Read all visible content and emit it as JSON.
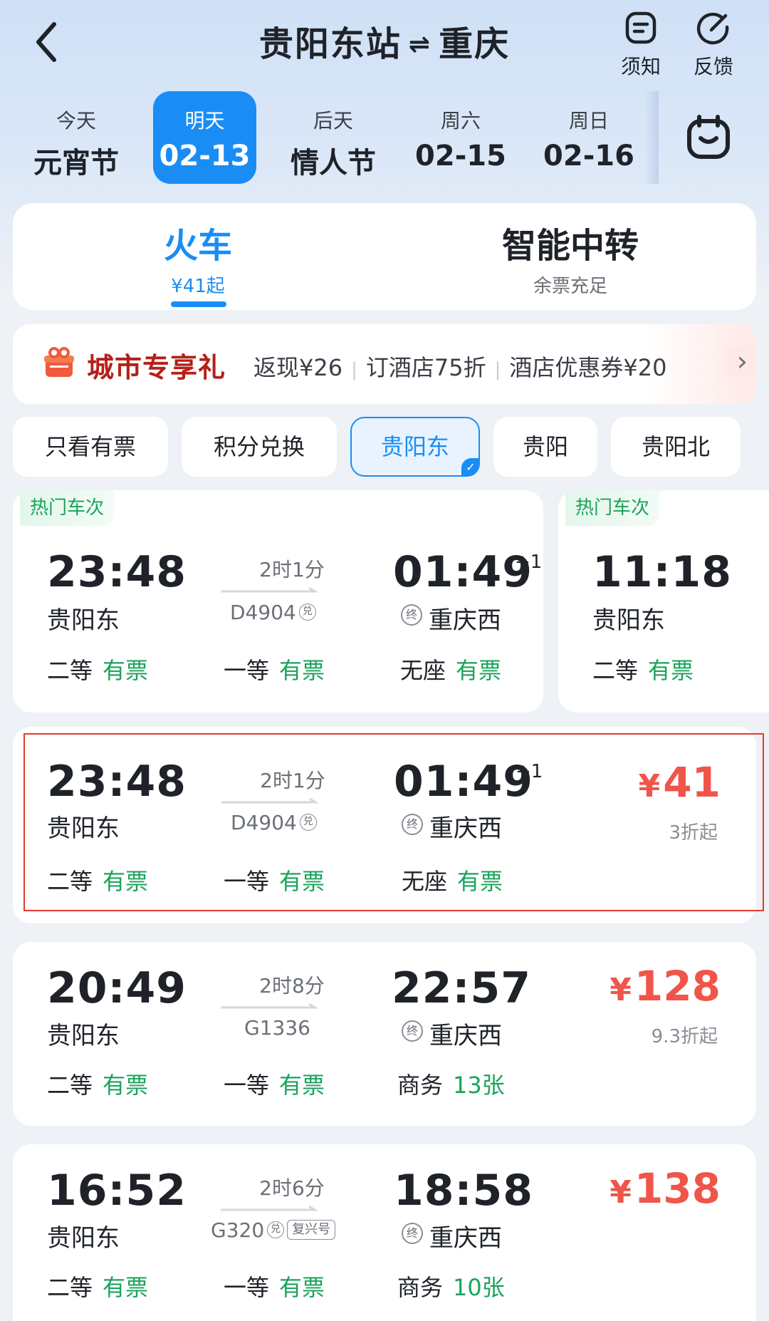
{
  "header": {
    "from": "贵阳东站",
    "swap": "⇌",
    "to": "重庆",
    "notice_label": "须知",
    "feedback_label": "反馈"
  },
  "dates": [
    {
      "top": "今天",
      "bottom": "元宵节",
      "active": false
    },
    {
      "top": "明天",
      "bottom": "02-13",
      "active": true
    },
    {
      "top": "后天",
      "bottom": "情人节",
      "active": false
    },
    {
      "top": "周六",
      "bottom": "02-15",
      "active": false
    },
    {
      "top": "周日",
      "bottom": "02-16",
      "active": false
    }
  ],
  "modes": {
    "train": {
      "title": "火车",
      "sub": "¥41起"
    },
    "transfer": {
      "title": "智能中转",
      "sub": "余票充足"
    }
  },
  "promo": {
    "title": "城市专享礼",
    "items": [
      "返现¥26",
      "订酒店75折",
      "酒店优惠券¥20"
    ],
    "chevron": "›"
  },
  "filters": [
    {
      "label": "只看有票",
      "active": false
    },
    {
      "label": "积分兑换",
      "active": false
    },
    {
      "label": "贵阳东",
      "active": true
    },
    {
      "label": "贵阳",
      "active": false
    },
    {
      "label": "贵阳北",
      "active": false
    }
  ],
  "hot_cards": {
    "card1": {
      "tag": "热门车次",
      "dep_time": "23:48",
      "dep_station": "贵阳东",
      "duration": "2时1分",
      "train_no": "D4904",
      "train_badge": "兑",
      "arr_time": "01:49",
      "plus_day": "+1",
      "arr_station": "重庆西",
      "terminal_icon": "终",
      "seats": [
        {
          "class": "二等",
          "status": "有票"
        },
        {
          "class": "一等",
          "status": "有票"
        },
        {
          "class": "无座",
          "status": "有票"
        }
      ]
    },
    "card2": {
      "tag": "热门车次",
      "dep_time": "11:18",
      "dep_station": "贵阳东",
      "seats": [
        {
          "class": "二等",
          "status": "有票"
        }
      ]
    }
  },
  "trains": [
    {
      "dep_time": "23:48",
      "dep_station": "贵阳东",
      "duration": "2时1分",
      "train_no": "D4904",
      "train_badge": "兑",
      "arr_time": "01:49",
      "plus_day": "+1",
      "arr_station": "重庆西",
      "terminal_icon": "终",
      "price_symbol": "¥",
      "price": "41",
      "discount": "3折起",
      "seats": [
        {
          "class": "二等",
          "status": "有票"
        },
        {
          "class": "一等",
          "status": "有票"
        },
        {
          "class": "无座",
          "status": "有票"
        }
      ]
    },
    {
      "dep_time": "20:49",
      "dep_station": "贵阳东",
      "duration": "2时8分",
      "train_no": "G1336",
      "arr_time": "22:57",
      "arr_station": "重庆西",
      "terminal_icon": "终",
      "price_symbol": "¥",
      "price": "128",
      "discount": "9.3折起",
      "seats": [
        {
          "class": "二等",
          "status": "有票"
        },
        {
          "class": "一等",
          "status": "有票"
        },
        {
          "class": "商务",
          "status": "13张"
        }
      ]
    },
    {
      "dep_time": "16:52",
      "dep_station": "贵阳东",
      "duration": "2时6分",
      "train_no": "G320",
      "train_badge": "兑",
      "train_badge2": "复兴号",
      "arr_time": "18:58",
      "arr_station": "重庆西",
      "terminal_icon": "终",
      "price_symbol": "¥",
      "price": "138",
      "seats": [
        {
          "class": "二等",
          "status": "有票"
        },
        {
          "class": "一等",
          "status": "有票"
        },
        {
          "class": "商务",
          "status": "10张"
        }
      ]
    }
  ],
  "colors": {
    "accent": "#1a8df5",
    "available": "#1aa35b",
    "price": "#f0554a",
    "promo_title": "#b5201a",
    "highlight": "#e23b2e"
  }
}
